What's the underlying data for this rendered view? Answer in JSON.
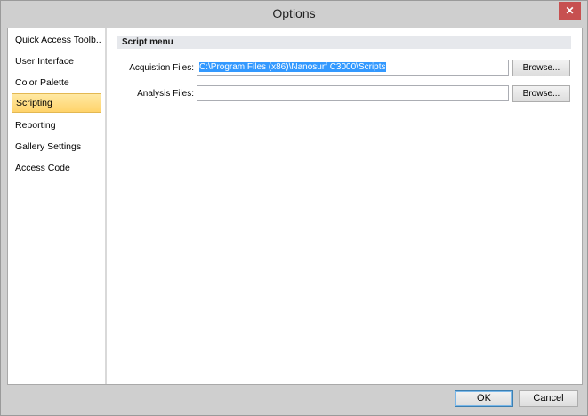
{
  "window": {
    "title": "Options",
    "close_glyph": "✕"
  },
  "nav": {
    "items": [
      {
        "label": "Quick Access Toolb..."
      },
      {
        "label": "User Interface"
      },
      {
        "label": "Color Palette"
      },
      {
        "label": "Scripting",
        "selected": true
      },
      {
        "label": "Reporting"
      },
      {
        "label": "Gallery Settings"
      },
      {
        "label": "Access Code"
      }
    ]
  },
  "scripting": {
    "section_title": "Script menu",
    "acquisition": {
      "label": "Acquistion Files:",
      "value": "C:\\Program Files (x86)\\Nanosurf C3000\\Scripts",
      "browse_label": "Browse..."
    },
    "analysis": {
      "label": "Analysis Files:",
      "value": "",
      "browse_label": "Browse..."
    }
  },
  "footer": {
    "ok_label": "OK",
    "cancel_label": "Cancel"
  },
  "colors": {
    "selection_highlight": "#ffd36a",
    "text_selection": "#3399ff",
    "close_button": "#c75050"
  }
}
